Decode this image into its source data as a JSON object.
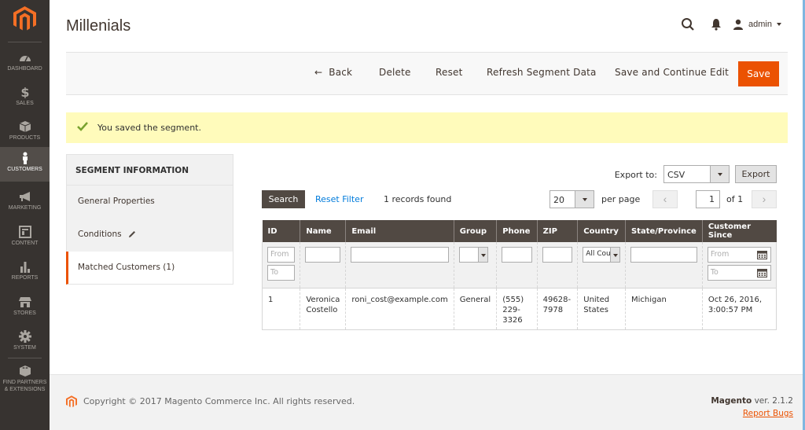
{
  "sidebar": {
    "items": [
      {
        "label": "DASHBOARD",
        "icon": "dashboard-icon"
      },
      {
        "label": "SALES",
        "icon": "dollar-icon"
      },
      {
        "label": "PRODUCTS",
        "icon": "box-icon"
      },
      {
        "label": "CUSTOMERS",
        "icon": "person-icon",
        "active": true
      },
      {
        "label": "MARKETING",
        "icon": "megaphone-icon"
      },
      {
        "label": "CONTENT",
        "icon": "layout-icon"
      },
      {
        "label": "REPORTS",
        "icon": "bar-chart-icon"
      },
      {
        "label": "STORES",
        "icon": "store-icon"
      },
      {
        "label": "SYSTEM",
        "icon": "gear-icon"
      },
      {
        "label": "FIND PARTNERS & EXTENSIONS",
        "icon": "blocks-icon"
      }
    ]
  },
  "header": {
    "title": "Millenials",
    "user": "admin"
  },
  "actions": {
    "back": "Back",
    "delete": "Delete",
    "reset": "Reset",
    "refresh": "Refresh Segment Data",
    "save_continue": "Save and Continue Edit",
    "save": "Save"
  },
  "message": {
    "text": "You saved the segment.",
    "type": "success"
  },
  "tabs": {
    "heading": "SEGMENT INFORMATION",
    "items": [
      {
        "label": "General Properties"
      },
      {
        "label": "Conditions",
        "edited": true
      },
      {
        "label": "Matched Customers (1)",
        "active": true
      }
    ]
  },
  "grid": {
    "export_label": "Export to:",
    "export_format": "CSV",
    "export_button": "Export",
    "search_button": "Search",
    "reset_filter": "Reset Filter",
    "records_found": "1 records found",
    "per_page_value": "20",
    "per_page_label": "per page",
    "page_current": "1",
    "page_total_label": "of 1",
    "columns": [
      "ID",
      "Name",
      "Email",
      "Group",
      "Phone",
      "ZIP",
      "Country",
      "State/Province",
      "Customer Since"
    ],
    "filters": {
      "id_from_placeholder": "From",
      "id_to_placeholder": "To",
      "country_value": "All Cou",
      "since_from_placeholder": "From",
      "since_to_placeholder": "To"
    },
    "rows": [
      {
        "id": "1",
        "name_first": "Veronica",
        "name_last": "Costello",
        "email": "roni_cost@example.com",
        "group": "General",
        "phone_l1": "(555)",
        "phone_l2": "229-",
        "phone_l3": "3326",
        "zip_l1": "49628-",
        "zip_l2": "7978",
        "country_l1": "United",
        "country_l2": "States",
        "state": "Michigan",
        "since": "Oct 26, 2016, 3:00:57 PM"
      }
    ]
  },
  "footer": {
    "copyright": "Copyright © 2017 Magento Commerce Inc. All rights reserved.",
    "brand": "Magento",
    "version": " ver. 2.1.2",
    "report_bugs": "Report Bugs"
  },
  "colors": {
    "accent": "#eb5202",
    "sidebar_bg": "#373330",
    "grid_header": "#514943",
    "message_bg": "#fffbbb",
    "link": "#007bdb"
  }
}
